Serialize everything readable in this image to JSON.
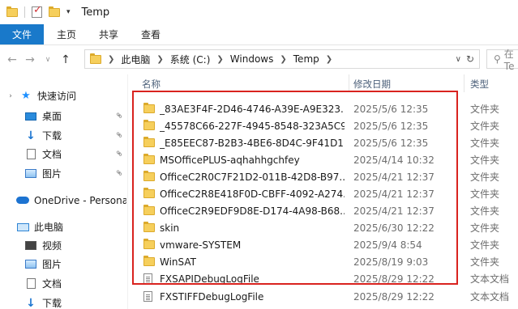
{
  "window": {
    "title": "Temp"
  },
  "ribbon": {
    "tabs": [
      "文件",
      "主页",
      "共享",
      "查看"
    ]
  },
  "address": {
    "crumbs": [
      "此电脑",
      "系统 (C:)",
      "Windows",
      "Temp"
    ]
  },
  "search": {
    "placeholder": "在 Te"
  },
  "sidebar": {
    "items": [
      {
        "label": "快速访问",
        "icon": "star-icon"
      },
      {
        "label": "桌面",
        "icon": "desktop-icon"
      },
      {
        "label": "下载",
        "icon": "download-icon"
      },
      {
        "label": "文档",
        "icon": "document-icon"
      },
      {
        "label": "图片",
        "icon": "pictures-icon"
      },
      {
        "label": "OneDrive - Persona",
        "icon": "onedrive-icon"
      },
      {
        "label": "此电脑",
        "icon": "this-pc-icon"
      },
      {
        "label": "视频",
        "icon": "videos-icon"
      },
      {
        "label": "图片",
        "icon": "pictures-icon"
      },
      {
        "label": "文档",
        "icon": "document-icon"
      },
      {
        "label": "下载",
        "icon": "download-icon"
      }
    ]
  },
  "columns": {
    "name": "名称",
    "date": "修改日期",
    "type": "类型"
  },
  "files": [
    {
      "name": "_83AE3F4F-2D46-4746-A39E-A9E323...",
      "date": "2025/5/6 12:35",
      "type": "文件夹",
      "icon": "folder-icon"
    },
    {
      "name": "_45578C66-227F-4945-8548-323A5C9...",
      "date": "2025/5/6 12:35",
      "type": "文件夹",
      "icon": "folder-icon"
    },
    {
      "name": "_E85EEC87-B2B3-4BE6-8D4C-9F41D1...",
      "date": "2025/5/6 12:35",
      "type": "文件夹",
      "icon": "folder-icon"
    },
    {
      "name": "MSOfficePLUS-aqhahhgchfey",
      "date": "2025/4/14 10:32",
      "type": "文件夹",
      "icon": "folder-icon"
    },
    {
      "name": "OfficeC2R0C7F21D2-011B-42D8-B97...",
      "date": "2025/4/21 12:37",
      "type": "文件夹",
      "icon": "folder-icon"
    },
    {
      "name": "OfficeC2R8E418F0D-CBFF-4092-A274...",
      "date": "2025/4/21 12:37",
      "type": "文件夹",
      "icon": "folder-icon"
    },
    {
      "name": "OfficeC2R9EDF9D8E-D174-4A98-B68...",
      "date": "2025/4/21 12:37",
      "type": "文件夹",
      "icon": "folder-icon"
    },
    {
      "name": "skin",
      "date": "2025/6/30 12:22",
      "type": "文件夹",
      "icon": "folder-icon"
    },
    {
      "name": "vmware-SYSTEM",
      "date": "2025/9/4 8:54",
      "type": "文件夹",
      "icon": "folder-icon"
    },
    {
      "name": "WinSAT",
      "date": "2025/8/19 9:03",
      "type": "文件夹",
      "icon": "folder-icon"
    },
    {
      "name": "FXSAPIDebugLogFile",
      "date": "2025/8/29 12:22",
      "type": "文本文档",
      "icon": "text-file-icon"
    },
    {
      "name": "FXSTIFFDebugLogFile",
      "date": "2025/8/29 12:22",
      "type": "文本文档",
      "icon": "text-file-icon"
    }
  ],
  "colors": {
    "file_tab": "#1979ca",
    "highlight_box": "#d9231f",
    "folder": "#f6cf5c"
  }
}
